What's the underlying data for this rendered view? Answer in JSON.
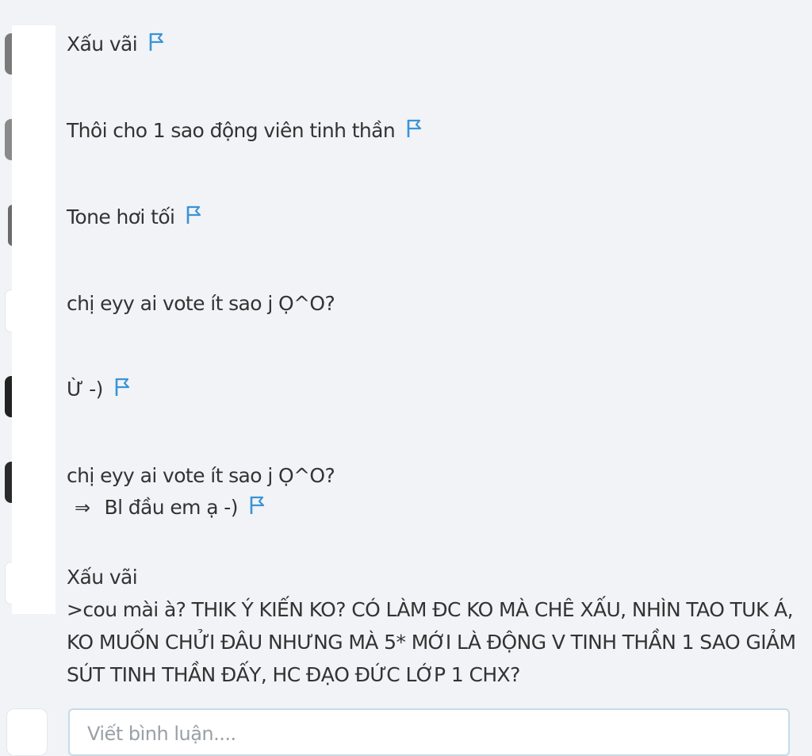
{
  "comments": [
    {
      "line1": "Xấu vãi",
      "flag_icon": "flag-icon"
    },
    {
      "line1": "Thôi cho 1 sao động viên tinh thần",
      "flag_icon": "flag-icon"
    },
    {
      "line1": "Tone hơi tối",
      "flag_icon": "flag-icon"
    },
    {
      "line1": "chị eyy ai vote ít sao j Ọ^O?"
    },
    {
      "line1": "Ừ -)",
      "flag_icon": "flag-icon"
    },
    {
      "quote": "chị eyy ai vote ít sao j Ọ^O?",
      "arrow": "⇒",
      "reply": "Bl đầu em ạ -)",
      "flag_icon": "flag-icon"
    },
    {
      "quote": "Xấu vãi",
      "reply": ">cou mài à? THIK Ý KIẾN KO? CÓ LÀM ĐC KO MÀ CHÊ XẤU, NHÌN TAO TUK Á, KO MUỐN CHỬI ĐÂU NHƯNG MÀ 5* MỚI LÀ ĐỘNG V TINH THẦN 1 SAO GIẢM SÚT TINH THẦN ĐẤY, HC ĐẠO ĐỨC LỚP 1 CHX?"
    }
  ],
  "comment_input": {
    "placeholder": "Viết bình luận...."
  },
  "colors": {
    "flag": "#3a93d6",
    "background": "#f1f3f6",
    "input_border": "#c6dbe6"
  }
}
